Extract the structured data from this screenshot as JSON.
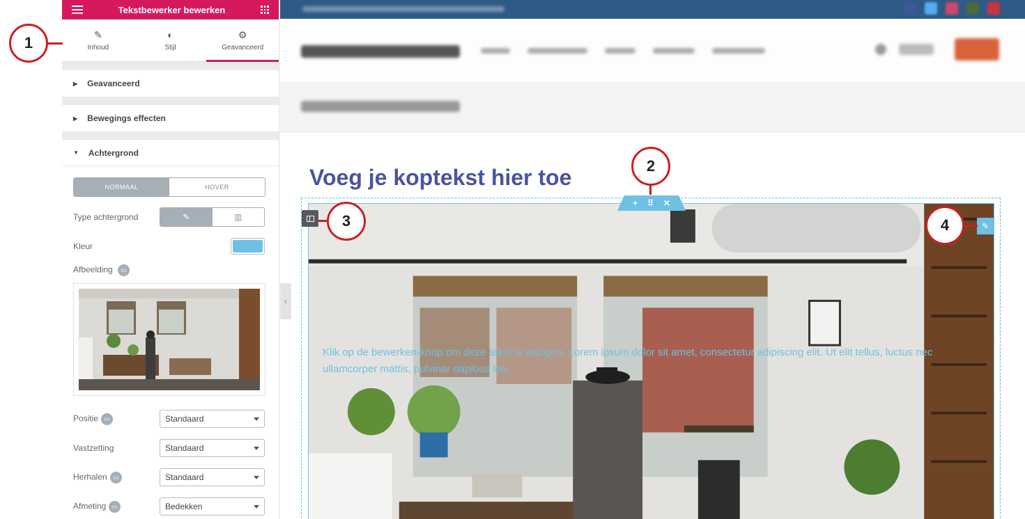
{
  "panel": {
    "title": "Tekstbewerker bewerken",
    "tabs": [
      {
        "label": "Inhoud",
        "icon": "pencil-icon"
      },
      {
        "label": "Stijl",
        "icon": "contrast-icon"
      },
      {
        "label": "Geavanceerd",
        "icon": "gear-icon",
        "active": true
      }
    ],
    "sections": {
      "geavanceerd": "Geavanceerd",
      "bewegings": "Bewegings effecten",
      "achtergrond": "Achtergrond"
    },
    "background": {
      "state_tabs": [
        "NORMAAL",
        "HOVER"
      ],
      "type_label": "Type achtergrond",
      "color_label": "Kleur",
      "color_value": "#6ec1e4",
      "image_label": "Afbeelding",
      "fields": [
        {
          "label": "Positie",
          "value": "Standaard"
        },
        {
          "label": "Vastzetting",
          "value": "Standaard"
        },
        {
          "label": "Herhalen",
          "value": "Standaard"
        },
        {
          "label": "Afmeting",
          "value": "Bedekken"
        }
      ]
    }
  },
  "preview": {
    "heading": "Voeg je koptekst hier toe",
    "body_text": "Klik op de bewerken-knop om deze tekst te wijzigen. Lorem ipsum dolor sit amet, consectetur adipiscing elit. Ut elit tellus, luctus nec ullamcorper mattis, pulvinar dapibus leo.",
    "section_handle": {
      "add": "+",
      "move": "⠿",
      "close": "✕"
    }
  },
  "callouts": [
    "1",
    "2",
    "3",
    "4"
  ],
  "colors": {
    "brand": "#d5195c",
    "accent": "#6ec1e4",
    "heading": "#4a54a0",
    "callout": "#cc1f1f"
  }
}
